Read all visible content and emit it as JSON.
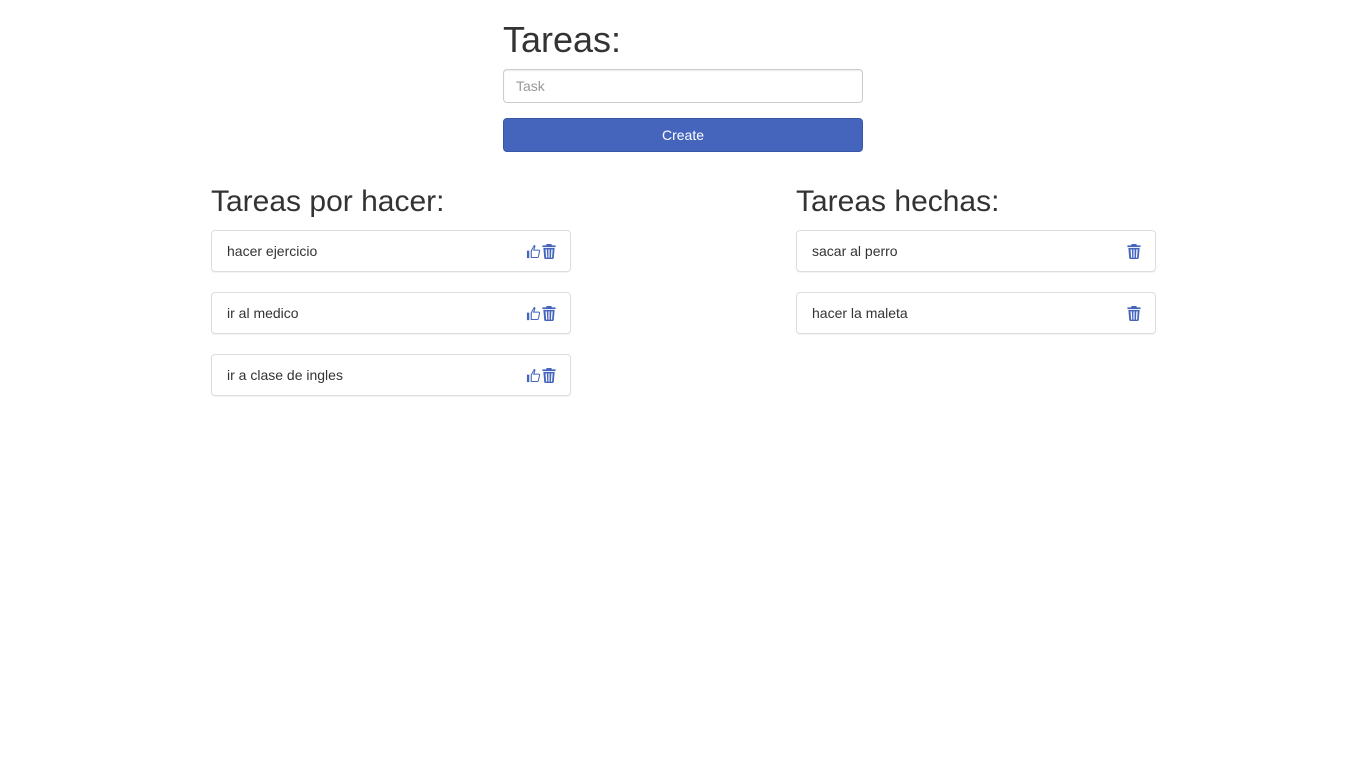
{
  "header": {
    "title": "Tareas:"
  },
  "form": {
    "task_placeholder": "Task",
    "task_value": "",
    "create_label": "Create"
  },
  "todo": {
    "title": "Tareas por hacer:",
    "items": [
      {
        "label": "hacer ejercicio"
      },
      {
        "label": "ir al medico"
      },
      {
        "label": "ir a clase de ingles"
      }
    ]
  },
  "done": {
    "title": "Tareas hechas:",
    "items": [
      {
        "label": "sacar al perro"
      },
      {
        "label": "hacer la maleta"
      }
    ]
  },
  "icons": {
    "complete": "thumbs-up-icon",
    "delete": "trash-icon"
  },
  "colors": {
    "accent": "#4565bd",
    "icon": "#4565bd"
  }
}
